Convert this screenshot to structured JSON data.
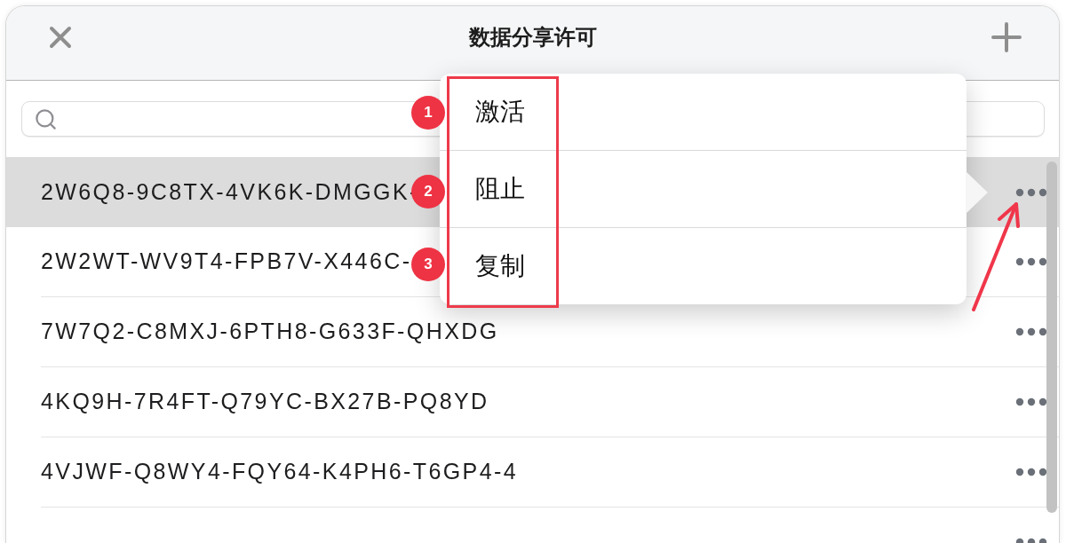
{
  "window": {
    "title": "数据分享许可"
  },
  "licenses": [
    {
      "key": "2W6Q8-9C8TX-4VK6K-DMGGK-",
      "selected": true
    },
    {
      "key": "2W2WT-WV9T4-FPB7V-X446C-",
      "selected": false
    },
    {
      "key": "7W7Q2-C8MXJ-6PTH8-G633F-QHXDG",
      "selected": false
    },
    {
      "key": "4KQ9H-7R4FT-Q79YC-BX27B-PQ8YD",
      "selected": false
    },
    {
      "key": "4VJWF-Q8WY4-FQY64-K4PH6-T6GP4-4",
      "selected": false
    },
    {
      "selected": false
    }
  ],
  "context_menu": {
    "items": [
      {
        "label": "激活"
      },
      {
        "label": "阻止"
      },
      {
        "label": "复制"
      }
    ]
  },
  "annotations": {
    "markers": [
      {
        "label": "1"
      },
      {
        "label": "2"
      },
      {
        "label": "3"
      }
    ]
  }
}
